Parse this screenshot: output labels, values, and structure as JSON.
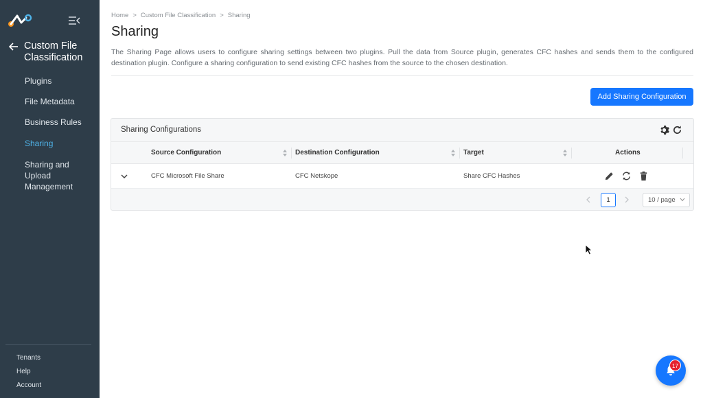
{
  "sidebar": {
    "back_title": "Custom File Classification",
    "items": [
      {
        "label": "Plugins"
      },
      {
        "label": "File Metadata"
      },
      {
        "label": "Business Rules"
      },
      {
        "label": "Sharing",
        "active": true
      },
      {
        "label": "Sharing and Upload Management"
      }
    ],
    "footer": [
      {
        "label": "Tenants"
      },
      {
        "label": "Help"
      },
      {
        "label": "Account"
      }
    ]
  },
  "breadcrumb": [
    "Home",
    "Custom File Classification",
    "Sharing"
  ],
  "breadcrumb_separator": ">",
  "page": {
    "title": "Sharing",
    "description": "The Sharing Page allows users to configure sharing settings between two plugins. Pull the data from Source plugin, generates CFC hashes and sends them to the configured destination plugin. Configure a sharing configuration to send existing CFC hashes from the source to the chosen destination.",
    "add_button_label": "Add Sharing Configuration"
  },
  "table": {
    "title": "Sharing Configurations",
    "columns": [
      "Source Configuration",
      "Destination Configuration",
      "Target",
      "Actions"
    ],
    "rows": [
      {
        "source": "CFC Microsoft File Share",
        "destination": "CFC Netskope",
        "target": "Share CFC Hashes"
      }
    ],
    "pagination": {
      "current_page": "1",
      "page_size": "10 / page"
    }
  },
  "notifications": {
    "count": "17"
  },
  "colors": {
    "sidebar_bg": "#2e3d49",
    "accent": "#1677ff",
    "active_nav": "#4fb3e8",
    "badge": "#e5202e"
  },
  "icons": [
    "logo-icon",
    "menu-collapse-icon",
    "arrow-left-icon",
    "gear-icon",
    "refresh-icon",
    "sort-icon",
    "chevron-down-icon",
    "pencil-icon",
    "sync-icon",
    "trash-icon",
    "chevron-left-icon",
    "chevron-right-icon",
    "bell-icon"
  ]
}
